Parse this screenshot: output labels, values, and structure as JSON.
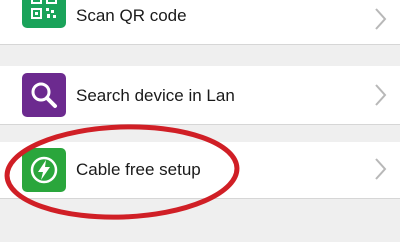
{
  "list": {
    "items": [
      {
        "label": "Scan QR code",
        "icon": "qr-code-icon",
        "icon_color": "#1aa35a"
      },
      {
        "label": "Search device in Lan",
        "icon": "magnifier-icon",
        "icon_color": "#6c2a8f"
      },
      {
        "label": "Cable free setup",
        "icon": "lightning-icon",
        "icon_color": "#2aa63c"
      }
    ]
  },
  "annotation": {
    "color": "#d01f26"
  }
}
